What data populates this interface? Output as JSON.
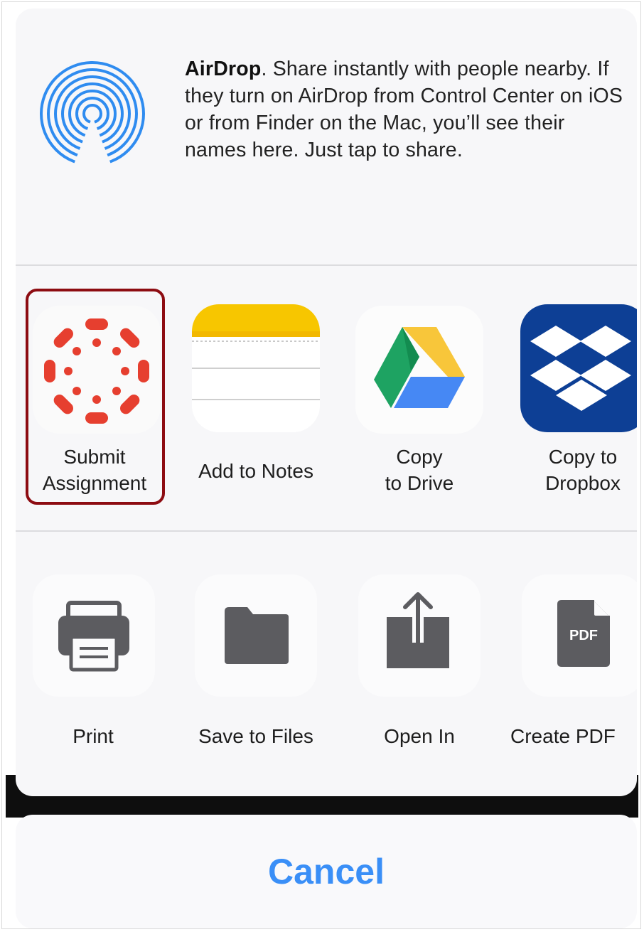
{
  "airdrop": {
    "title": "AirDrop",
    "description": ". Share instantly with people nearby. If they turn on AirDrop from Control Center on iOS or from Finder on the Mac, you’ll see their names here. Just tap to share.",
    "icon": "airdrop-icon",
    "color": "#2f8cf0"
  },
  "apps": [
    {
      "label_line1": "Submit",
      "label_line2": "Assignment",
      "icon": "canvas-icon",
      "color": "#e63f2f",
      "highlighted": true
    },
    {
      "label_line1": "Add to Notes",
      "label_line2": "",
      "icon": "notes-icon",
      "color": "#f5c400"
    },
    {
      "label_line1": "Copy",
      "label_line2": "to Drive",
      "icon": "google-drive-icon"
    },
    {
      "label_line1": "Copy to",
      "label_line2": "Dropbox",
      "icon": "dropbox-icon",
      "color": "#0d3f95"
    }
  ],
  "actions": [
    {
      "label": "Print",
      "icon": "printer-icon"
    },
    {
      "label": "Save to Files",
      "icon": "folder-icon"
    },
    {
      "label": "Open In",
      "icon": "share-icon"
    },
    {
      "label": "Create PDF",
      "icon": "pdf-icon",
      "icon_text": "PDF"
    }
  ],
  "cancel": {
    "label": "Cancel",
    "color": "#3a8ff7"
  },
  "highlight_color": "#8d0c12"
}
